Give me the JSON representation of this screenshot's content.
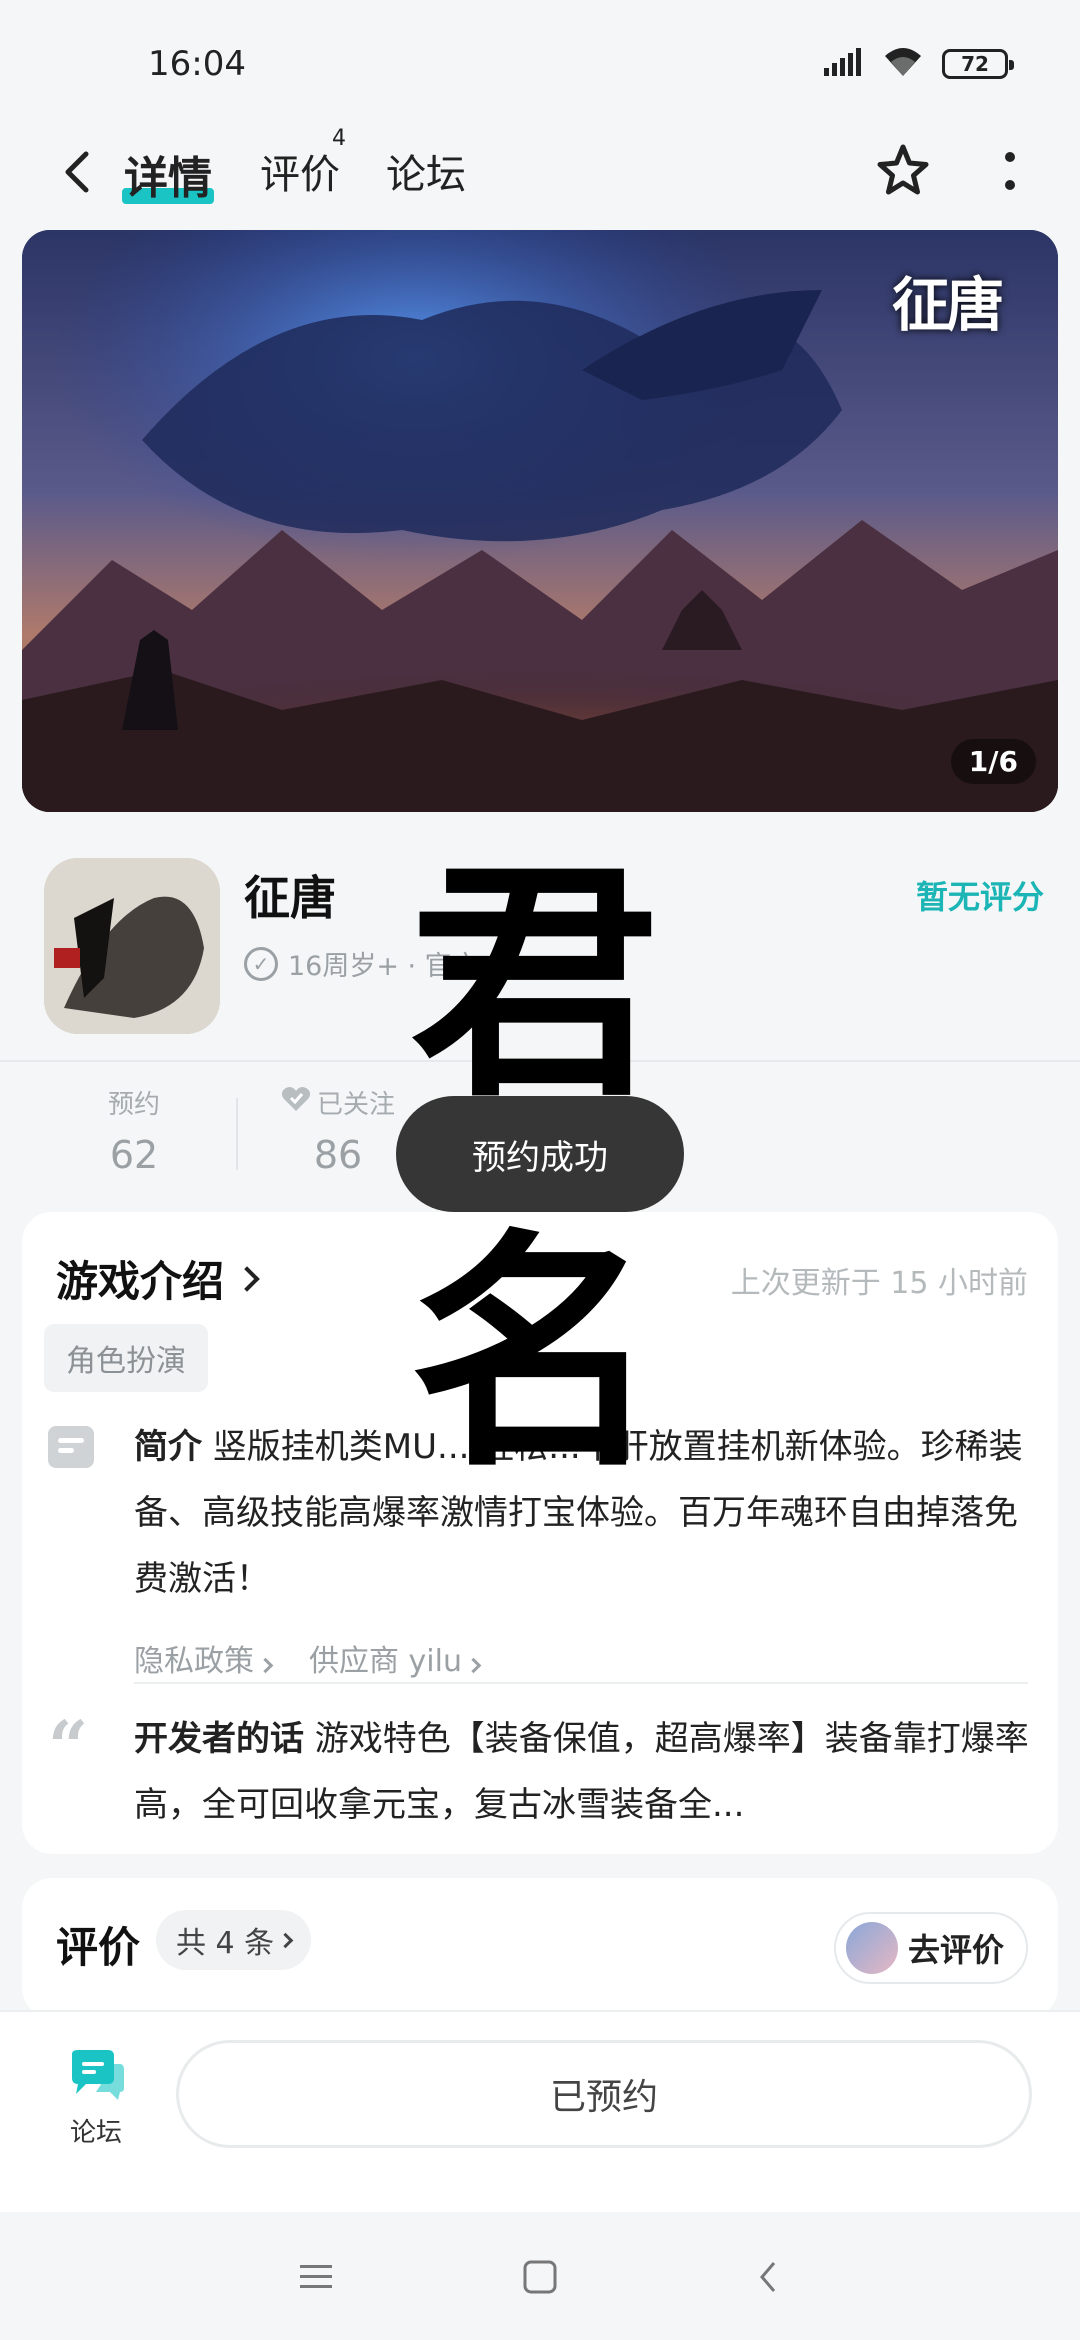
{
  "status_bar": {
    "time": "16:04",
    "battery": "72"
  },
  "nav": {
    "tabs": [
      {
        "label": "详情"
      },
      {
        "label": "评价"
      },
      {
        "label": "论坛"
      }
    ],
    "review_superscript": "4"
  },
  "banner": {
    "counter": "1/6",
    "logo": "征唐"
  },
  "game": {
    "title": "征唐",
    "tags": "16周岁+ · 官方 ...",
    "rating": "暂无评分"
  },
  "stats": [
    {
      "label": "预约",
      "value": "62"
    },
    {
      "label": "已关注",
      "value": "86"
    }
  ],
  "toast": "预约成功",
  "intro": {
    "title": "游戏介绍",
    "updated": "上次更新于 15 小时前",
    "genre": "角色扮演",
    "summary_label": "简介",
    "summary": " 竖版挂机类MU... 轻松...不肝放置挂机新体验。珍稀装备、高级技能高爆率激情打宝体验。百万年魂环自由掉落免费激活！",
    "privacy_link": "隐私政策",
    "supplier_link": "供应商 yilu",
    "dev_label": "开发者的话",
    "dev_text": " 游戏特色【装备保值，超高爆率】装备靠打爆率高，全可回收拿元宝，复古冰雪装备全..."
  },
  "reviews": {
    "title": "评价",
    "count": "共 4 条",
    "go_review": "去评价"
  },
  "bottom": {
    "forum_label": "论坛",
    "reserved": "已预约"
  },
  "watermark": {
    "line1": "君",
    "line2": "名"
  }
}
